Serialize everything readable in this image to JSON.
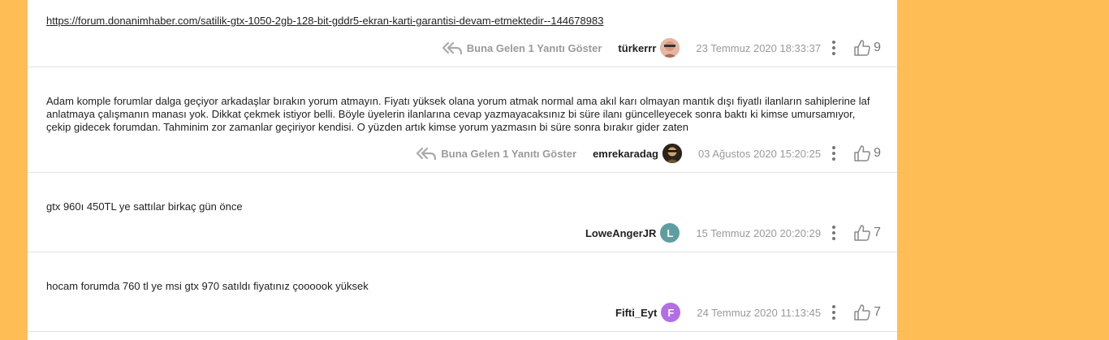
{
  "posts": [
    {
      "text": "https://forum.donanimhaber.com/satilik-gtx-1050-2gb-128-bit-gddr5-ekran-karti-garantisi-devam-etmektedir--144678983",
      "is_link": true,
      "reply_label": "Buna Gelen 1 Yanıtı Göster",
      "author": "türkerrr",
      "avatar_letter": "",
      "avatar_color": "#c99a7c",
      "date": "23 Temmuz 2020 18:33:37",
      "likes": "9"
    },
    {
      "text": "Adam komple forumlar dalga geçiyor arkadaşlar bırakın yorum atmayın. Fiyatı yüksek olana yorum atmak normal ama akıl karı olmayan mantık dışı fiyatlı ilanların sahiplerine laf anlatmaya çalışmanın manası yok. Dikkat çekmek istiyor belli. Böyle üyelerin ilanlarına cevap yazmayacaksınız bi süre ilanı güncelleyecek sonra baktı ki kimse umursamıyor, çekip gidecek forumdan. Tahminim zor zamanlar geçiriyor kendisi. O yüzden artık kimse yorum yazmasın bi süre sonra bırakır gider zaten",
      "is_link": false,
      "reply_label": "Buna Gelen 1 Yanıtı Göster",
      "author": "emrekaradag",
      "avatar_letter": "",
      "avatar_color": "#3a3020",
      "date": "03 Ağustos 2020 15:20:25",
      "likes": "9"
    },
    {
      "text": "gtx 960ı 450TL ye sattılar birkaç gün önce",
      "is_link": false,
      "reply_label": "",
      "author": "LoweAngerJR",
      "avatar_letter": "L",
      "avatar_color": "#5f9ea0",
      "date": "15 Temmuz 2020 20:20:29",
      "likes": "7"
    },
    {
      "text": "hocam forumda 760 tl ye msi gtx 970 satıldı fiyatınız çoooook yüksek",
      "is_link": false,
      "reply_label": "",
      "author": "Fifti_Eyt",
      "avatar_letter": "F",
      "avatar_color": "#b36ee6",
      "date": "24 Temmuz 2020 11:13:45",
      "likes": "7"
    }
  ],
  "icons": {
    "reply": "reply-all-icon",
    "more": "more-vertical-icon",
    "like": "thumbs-up-icon"
  }
}
